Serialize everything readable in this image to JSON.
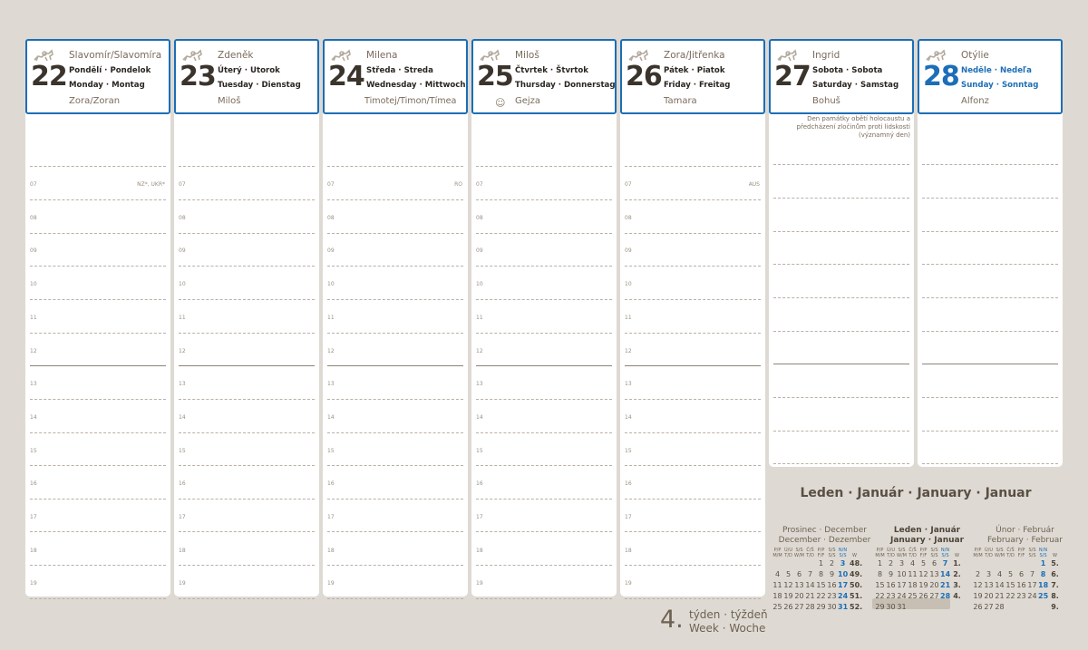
{
  "days": [
    {
      "num": "22",
      "name": "Slavomír/Slavomíra",
      "wd1": "Pondělí · Pondelok",
      "wd2": "Monday · Montag",
      "name2": "Zora/Zoran",
      "cc": "NZ*, UKR*",
      "note": ""
    },
    {
      "num": "23",
      "name": "Zdeněk",
      "wd1": "Úterý · Utorok",
      "wd2": "Tuesday · Dienstag",
      "name2": "Miloš",
      "cc": "",
      "note": ""
    },
    {
      "num": "24",
      "name": "Milena",
      "wd1": "Středa · Streda",
      "wd2": "Wednesday · Mittwoch",
      "name2": "Timotej/Timon/Tímea",
      "cc": "RO",
      "note": ""
    },
    {
      "num": "25",
      "name": "Miloš",
      "wd1": "Čtvrtek · Štvrtok",
      "wd2": "Thursday · Donnerstag",
      "name2": "Gejza",
      "cc": "",
      "note": ""
    },
    {
      "num": "26",
      "name": "Zora/Jitřenka",
      "wd1": "Pátek · Piatok",
      "wd2": "Friday · Freitag",
      "name2": "Tamara",
      "cc": "AUS",
      "note": ""
    },
    {
      "num": "27",
      "name": "Ingrid",
      "wd1": "Sobota · Sobota",
      "wd2": "Saturday · Samstag",
      "name2": "Bohuš",
      "cc": "",
      "note": "Den památky obětí holocaustu a předcházení zločinům proti lidskosti (významný den)"
    },
    {
      "num": "28",
      "name": "Otýlie",
      "wd1": "Neděle · Nedeľa",
      "wd2": "Sunday · Sonntag",
      "name2": "Alfonz",
      "cc": "",
      "note": ""
    }
  ],
  "hours": [
    "07",
    "08",
    "09",
    "10",
    "11",
    "12",
    "13",
    "14",
    "15",
    "16",
    "17",
    "18",
    "19"
  ],
  "icons": {
    "horse": "horse-rider-icon",
    "smiley": "smiley-icon"
  },
  "colors": {
    "accent": "#1c6eb7",
    "text": "#6e6152",
    "bg": "#dedad3"
  },
  "calendar_title": "Leden · Január · January · Januar",
  "week": {
    "number": "4.",
    "label1": "týden · týždeň",
    "label2": "Week · Woche"
  },
  "mini_calendars": [
    {
      "title1": "Prosinec · December",
      "title2": "December · Dezember",
      "current": false,
      "rows": [
        [
          "",
          "",
          "",
          "",
          "1",
          "2",
          "3",
          "48."
        ],
        [
          "4",
          "5",
          "6",
          "7",
          "8",
          "9",
          "10",
          "49."
        ],
        [
          "11",
          "12",
          "13",
          "14",
          "15",
          "16",
          "17",
          "50."
        ],
        [
          "18",
          "19",
          "20",
          "21",
          "22",
          "23",
          "24",
          "51."
        ],
        [
          "25",
          "26",
          "27",
          "28",
          "29",
          "30",
          "31",
          "52."
        ]
      ]
    },
    {
      "title1": "Leden · Január",
      "title2": "January · Januar",
      "current": true,
      "rows": [
        [
          "1",
          "2",
          "3",
          "4",
          "5",
          "6",
          "7",
          "1."
        ],
        [
          "8",
          "9",
          "10",
          "11",
          "12",
          "13",
          "14",
          "2."
        ],
        [
          "15",
          "16",
          "17",
          "18",
          "19",
          "20",
          "21",
          "3."
        ],
        [
          "22",
          "23",
          "24",
          "25",
          "26",
          "27",
          "28",
          "4."
        ],
        [
          "29",
          "30",
          "31",
          "",
          "",
          "",
          "",
          ""
        ]
      ]
    },
    {
      "title1": "Únor · Február",
      "title2": "February · Februar",
      "current": false,
      "rows": [
        [
          "",
          "",
          "",
          "",
          "",
          "",
          "1",
          "5."
        ],
        [
          "2",
          "3",
          "4",
          "5",
          "6",
          "7",
          "8",
          "6."
        ],
        [
          "12",
          "13",
          "14",
          "15",
          "16",
          "17",
          "18",
          "7."
        ],
        [
          "19",
          "20",
          "21",
          "22",
          "23",
          "24",
          "25",
          "8."
        ],
        [
          "26",
          "27",
          "28",
          "",
          "",
          "",
          "",
          "9."
        ]
      ]
    }
  ],
  "weekday_headers": [
    [
      "P/P",
      "M/M"
    ],
    [
      "Ú/U",
      "T/D"
    ],
    [
      "S/S",
      "W/M"
    ],
    [
      "Č/Š",
      "T/D"
    ],
    [
      "P/P",
      "F/F"
    ],
    [
      "S/S",
      "S/S"
    ],
    [
      "N/N",
      "S/S"
    ],
    [
      "",
      "W"
    ]
  ]
}
